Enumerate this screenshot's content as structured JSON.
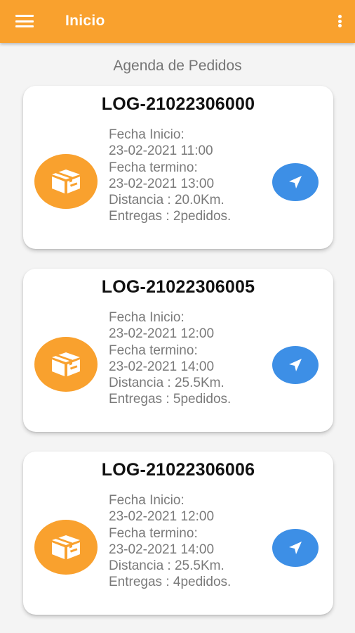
{
  "appbar": {
    "title": "Inicio",
    "menu_icon": "hamburger-menu-icon",
    "more_icon": "more-vert-icon",
    "color": "#f9a12e"
  },
  "page": {
    "title": "Agenda de Pedidos"
  },
  "orders": [
    {
      "code": "LOG-21022306000",
      "fecha_inicio_label": "Fecha Inicio:",
      "fecha_inicio": "23-02-2021 11:00",
      "fecha_termino_label": "Fecha termino:",
      "fecha_termino": "23-02-2021 13:00",
      "distancia": "Distancia : 20.0Km.",
      "entregas": "Entregas : 2pedidos."
    },
    {
      "code": "LOG-21022306005",
      "fecha_inicio_label": "Fecha Inicio:",
      "fecha_inicio": "23-02-2021 12:00",
      "fecha_termino_label": "Fecha termino:",
      "fecha_termino": "23-02-2021 14:00",
      "distancia": "Distancia : 25.5Km.",
      "entregas": "Entregas : 5pedidos."
    },
    {
      "code": "LOG-21022306006",
      "fecha_inicio_label": "Fecha Inicio:",
      "fecha_inicio": "23-02-2021 12:00",
      "fecha_termino_label": "Fecha termino:",
      "fecha_termino": "23-02-2021 14:00",
      "distancia": "Distancia : 25.5Km.",
      "entregas": "Entregas : 4pedidos."
    }
  ],
  "colors": {
    "accent": "#f9a12e",
    "nav_button": "#3d8fe6",
    "detail_text": "#7a7a7a"
  },
  "icons": {
    "order_icon": "package-box-icon",
    "nav_icon": "navigation-arrow-icon"
  }
}
